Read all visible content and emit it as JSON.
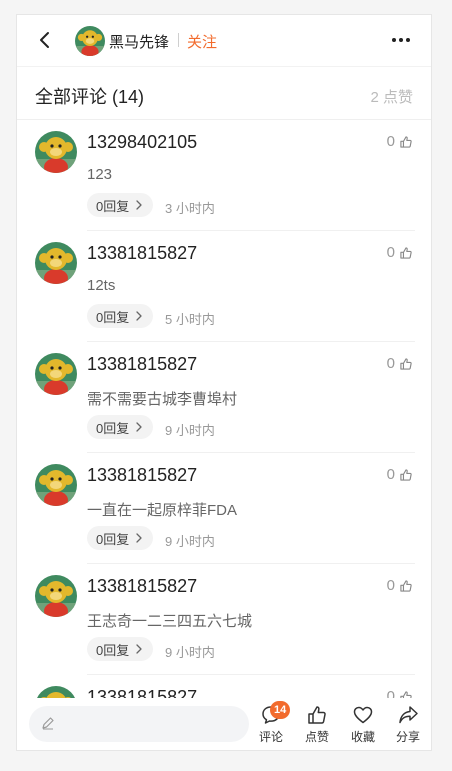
{
  "header": {
    "author_name": "黑马先锋",
    "follow_label": "关注"
  },
  "section": {
    "title": "全部评论 (14)",
    "likes": "2 点赞"
  },
  "comments": [
    {
      "user": "13298402105",
      "likes": "0",
      "text": "123",
      "replies": "0回复",
      "time": "3 小时内"
    },
    {
      "user": "13381815827",
      "likes": "0",
      "text": "12ts",
      "replies": "0回复",
      "time": "5 小时内"
    },
    {
      "user": "13381815827",
      "likes": "0",
      "text": "需不需要古城李曹埠村",
      "replies": "0回复",
      "time": "9 小时内"
    },
    {
      "user": "13381815827",
      "likes": "0",
      "text": "一直在一起原梓菲FDA",
      "replies": "0回复",
      "time": "9 小时内"
    },
    {
      "user": "13381815827",
      "likes": "0",
      "text": "王志奇一二三四五六七城",
      "replies": "0回复",
      "time": "9 小时内"
    },
    {
      "user": "13381815827",
      "likes": "0",
      "text": "",
      "replies": "",
      "time": ""
    }
  ],
  "bottom": {
    "comment_badge": "14",
    "actions": {
      "comment": "评论",
      "like": "点赞",
      "favorite": "收藏",
      "share": "分享"
    }
  },
  "colors": {
    "accent": "#f26b2d",
    "avatar_bg": "#3f8a5f",
    "avatar_face": "#e3b82c",
    "avatar_shirt": "#d93a2b"
  }
}
